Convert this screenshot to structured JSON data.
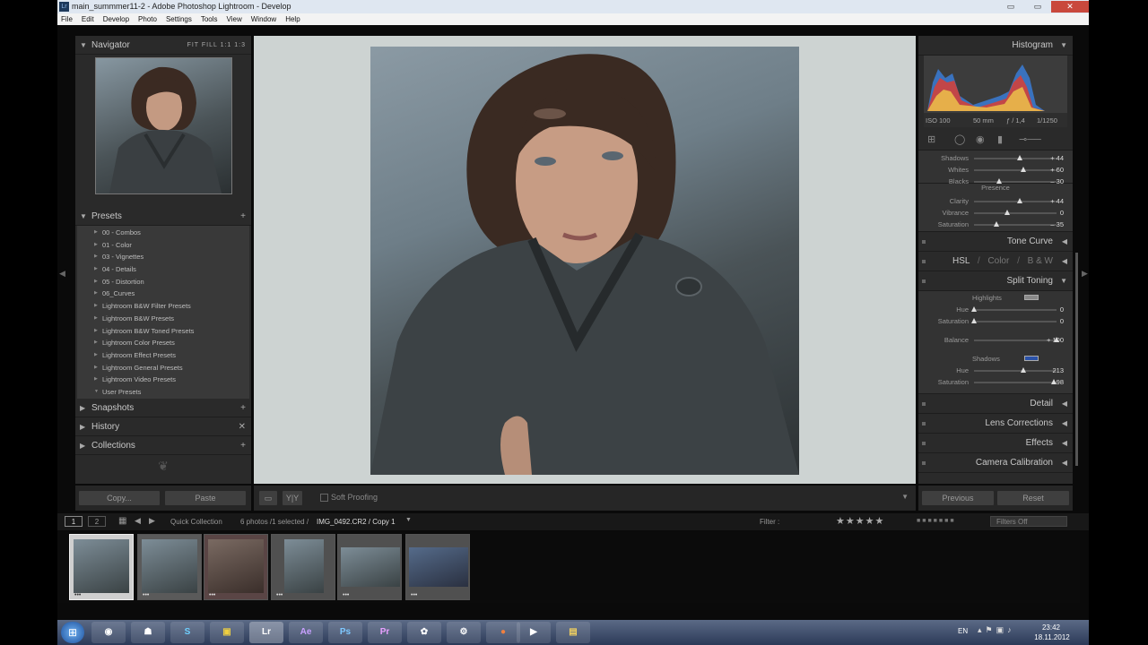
{
  "window": {
    "title": "main_summmer11-2 - Adobe Photoshop Lightroom - Develop",
    "app_icon": "Lr",
    "min": "▭",
    "max": "▭",
    "close": "✕"
  },
  "menu": [
    "File",
    "Edit",
    "Develop",
    "Photo",
    "Settings",
    "Tools",
    "View",
    "Window",
    "Help"
  ],
  "left": {
    "navigator": {
      "title": "Navigator",
      "zoom_options": "FIT  FILL  1:1  1:3"
    },
    "presets": {
      "title": "Presets",
      "add": "+",
      "items": [
        "00 - Combos",
        "01 - Color",
        "03 - Vignettes",
        "04 - Details",
        "05 - Distortion",
        "06_Curves",
        "Lightroom B&W Filter Presets",
        "Lightroom B&W Presets",
        "Lightroom B&W Toned Presets",
        "Lightroom Color Presets",
        "Lightroom Effect Presets",
        "Lightroom General Presets",
        "Lightroom Video Presets",
        "User Presets"
      ]
    },
    "snapshots": {
      "title": "Snapshots",
      "add": "+"
    },
    "history": {
      "title": "History",
      "clear": "✕"
    },
    "collections": {
      "title": "Collections",
      "add": "+"
    },
    "copy": "Copy...",
    "paste": "Paste"
  },
  "toolbar": {
    "soft_proofing": "Soft Proofing"
  },
  "right": {
    "histogram": {
      "title": "Histogram",
      "iso": "ISO 100",
      "focal": "50 mm",
      "aperture": "ƒ / 1,4",
      "shutter": "1/1250"
    },
    "basic": {
      "sliders": [
        {
          "label": "Shadows",
          "value": "+ 44",
          "pos": 0.55
        },
        {
          "label": "Whites",
          "value": "+ 60",
          "pos": 0.6
        },
        {
          "label": "Blacks",
          "value": "– 30",
          "pos": 0.3
        }
      ],
      "presence_label": "Presence",
      "presence": [
        {
          "label": "Clarity",
          "value": "+ 44",
          "pos": 0.55
        },
        {
          "label": "Vibrance",
          "value": "0",
          "pos": 0.4
        },
        {
          "label": "Saturation",
          "value": "– 35",
          "pos": 0.27
        }
      ]
    },
    "tone_curve": "Tone Curve",
    "hsl": {
      "hsl": "HSL",
      "color": "Color",
      "bw": "B & W",
      "sep": "/"
    },
    "split_toning": {
      "title": "Split Toning",
      "highlights_label": "Highlights",
      "highlights": [
        {
          "label": "Hue",
          "value": "0",
          "pos": 0.0
        },
        {
          "label": "Saturation",
          "value": "0",
          "pos": 0.0
        }
      ],
      "balance": {
        "label": "Balance",
        "value": "+ 100",
        "pos": 1.0
      },
      "shadows_label": "Shadows",
      "shadows": [
        {
          "label": "Hue",
          "value": "213",
          "pos": 0.6
        },
        {
          "label": "Saturation",
          "value": "98",
          "pos": 0.97
        }
      ]
    },
    "detail": "Detail",
    "lens": "Lens Corrections",
    "effects": "Effects",
    "calibration": "Camera Calibration",
    "previous": "Previous",
    "reset": "Reset"
  },
  "filmstrip_bar": {
    "page1": "1",
    "page2": "2",
    "source": "Quick Collection",
    "info": "6 photos /1 selected /",
    "file": "IMG_0492.CR2 / Copy 1",
    "filter_label": "Filter :",
    "stars": "★★★★★",
    "filters_off": "Filters Off"
  },
  "thumbnails": [
    "•••",
    "•••",
    "•••",
    "•••",
    "•••",
    "•••"
  ],
  "taskbar": {
    "apps": [
      "Chrome",
      "Game",
      "Skype",
      "Files",
      "Lr",
      "Ae",
      "Ps",
      "Pr",
      "Color",
      "Tool",
      "Guard",
      "Media",
      "Folder"
    ],
    "lang": "EN",
    "time": "23:42",
    "date": "18.11.2012"
  }
}
